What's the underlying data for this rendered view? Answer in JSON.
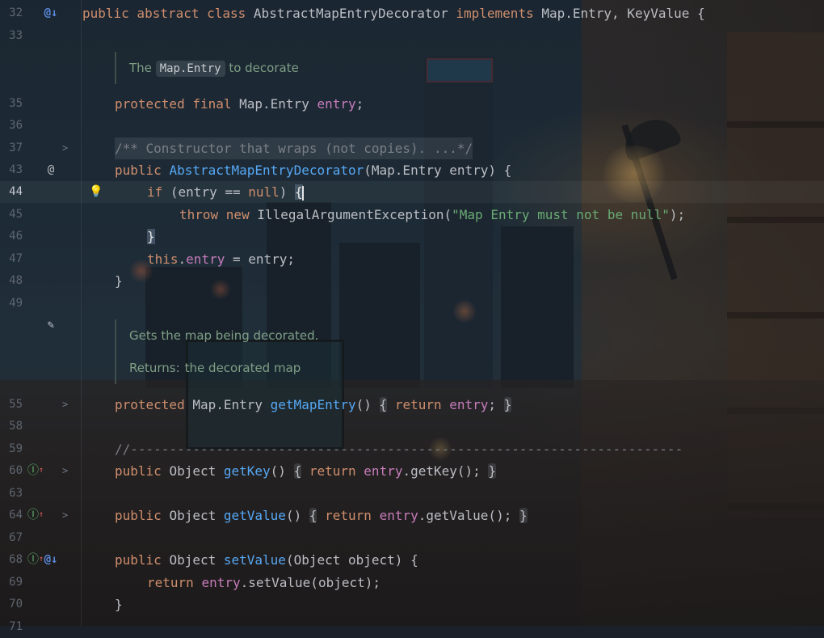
{
  "editor": {
    "lines": [
      {
        "no": "32",
        "code": [
          [
            "kw",
            "public abstract class "
          ],
          [
            "",
            "AbstractMapEntryDecorator "
          ],
          [
            "kw",
            "implements "
          ],
          [
            "",
            "Map.Entry, KeyValue {"
          ]
        ]
      },
      {
        "no": "33",
        "code": []
      },
      {
        "no": "35",
        "code": [
          [
            "kw",
            "protected final "
          ],
          [
            "",
            "Map.Entry "
          ],
          [
            "fld",
            "entry"
          ],
          [
            "",
            ";"
          ]
        ]
      },
      {
        "no": "36",
        "code": []
      },
      {
        "no": "37",
        "code": [
          [
            "cmt",
            "/** Constructor that wraps (not copies). ...*/"
          ]
        ]
      },
      {
        "no": "43",
        "code": [
          [
            "kw",
            "public "
          ],
          [
            "fn",
            "AbstractMapEntryDecorator"
          ],
          [
            "",
            "(Map.Entry entry) {"
          ]
        ]
      },
      {
        "no": "44",
        "code": [
          [
            "kw",
            "if "
          ],
          [
            "",
            "(entry == "
          ],
          [
            "kw",
            "null"
          ],
          [
            "",
            ") "
          ]
        ]
      },
      {
        "no": "45",
        "code": [
          [
            "kw",
            "throw new "
          ],
          [
            "",
            "IllegalArgumentException("
          ],
          [
            "str",
            "\"Map Entry must not be null\""
          ],
          [
            "",
            ");"
          ]
        ]
      },
      {
        "no": "46",
        "code": [
          [
            "bracket",
            "}"
          ]
        ]
      },
      {
        "no": "47",
        "code": [
          [
            "kw",
            "this"
          ],
          [
            "",
            "."
          ],
          [
            "fld",
            "entry"
          ],
          [
            "",
            " = entry;"
          ]
        ]
      },
      {
        "no": "48",
        "code": [
          [
            "",
            "}"
          ]
        ]
      },
      {
        "no": "49",
        "code": []
      },
      {
        "no": "55",
        "code": [
          [
            "kw",
            "protected "
          ],
          [
            "",
            "Map.Entry "
          ],
          [
            "fn",
            "getMapEntry"
          ],
          [
            "",
            "() "
          ],
          [
            "foldm",
            "{"
          ],
          [
            "",
            " "
          ],
          [
            "kw",
            "return "
          ],
          [
            "fld",
            "entry"
          ],
          [
            "",
            ";"
          ],
          [
            "",
            " "
          ],
          [
            "foldm",
            "}"
          ]
        ]
      },
      {
        "no": "58",
        "code": []
      },
      {
        "no": "59",
        "code": [
          [
            "cmt",
            "//-----------------------------------------------------------------------"
          ]
        ]
      },
      {
        "no": "60",
        "code": [
          [
            "kw",
            "public "
          ],
          [
            "",
            "Object "
          ],
          [
            "fn",
            "getKey"
          ],
          [
            "",
            "() "
          ],
          [
            "foldm",
            "{"
          ],
          [
            "",
            " "
          ],
          [
            "kw",
            "return "
          ],
          [
            "fld",
            "entry"
          ],
          [
            "",
            ".getKey();"
          ],
          [
            "",
            " "
          ],
          [
            "foldm",
            "}"
          ]
        ]
      },
      {
        "no": "63",
        "code": []
      },
      {
        "no": "64",
        "code": [
          [
            "kw",
            "public "
          ],
          [
            "",
            "Object "
          ],
          [
            "fn",
            "getValue"
          ],
          [
            "",
            "() "
          ],
          [
            "foldm",
            "{"
          ],
          [
            "",
            " "
          ],
          [
            "kw",
            "return "
          ],
          [
            "fld",
            "entry"
          ],
          [
            "",
            ".getValue();"
          ],
          [
            "",
            " "
          ],
          [
            "foldm",
            "}"
          ]
        ]
      },
      {
        "no": "67",
        "code": []
      },
      {
        "no": "68",
        "code": [
          [
            "kw",
            "public "
          ],
          [
            "",
            "Object "
          ],
          [
            "fn",
            "setValue"
          ],
          [
            "",
            "(Object object) {"
          ]
        ]
      },
      {
        "no": "69",
        "code": [
          [
            "kw",
            "return "
          ],
          [
            "fld",
            "entry"
          ],
          [
            "",
            ".setValue(object);"
          ]
        ]
      },
      {
        "no": "70",
        "code": [
          [
            "",
            "}"
          ]
        ]
      },
      {
        "no": "71",
        "code": []
      }
    ],
    "docs": {
      "field_doc_prefix": "The",
      "field_doc_code": "Map.Entry",
      "field_doc_suffix": "to decorate",
      "method_doc_summary": "Gets the map being decorated.",
      "method_doc_returns_label": "Returns:",
      "method_doc_returns_text": "the decorated map"
    },
    "gutter_icons": {
      "line32": "implemented-overridden-down-icon",
      "line43": "annotation-at-icon",
      "line44": "lightbulb-intention-icon",
      "javadoc_edit": "pencil-edit-icon",
      "line60": "implements-method-up-icon",
      "line64": "implements-method-up-icon",
      "line68": "implements-and-overridden-icon"
    },
    "caret_line": "44",
    "colors": {
      "keyword": "#cf8e6d",
      "method": "#56a8f5",
      "field": "#c77dbb",
      "string": "#6aab73",
      "comment": "#7a7e85",
      "text": "#bcbec4"
    }
  }
}
